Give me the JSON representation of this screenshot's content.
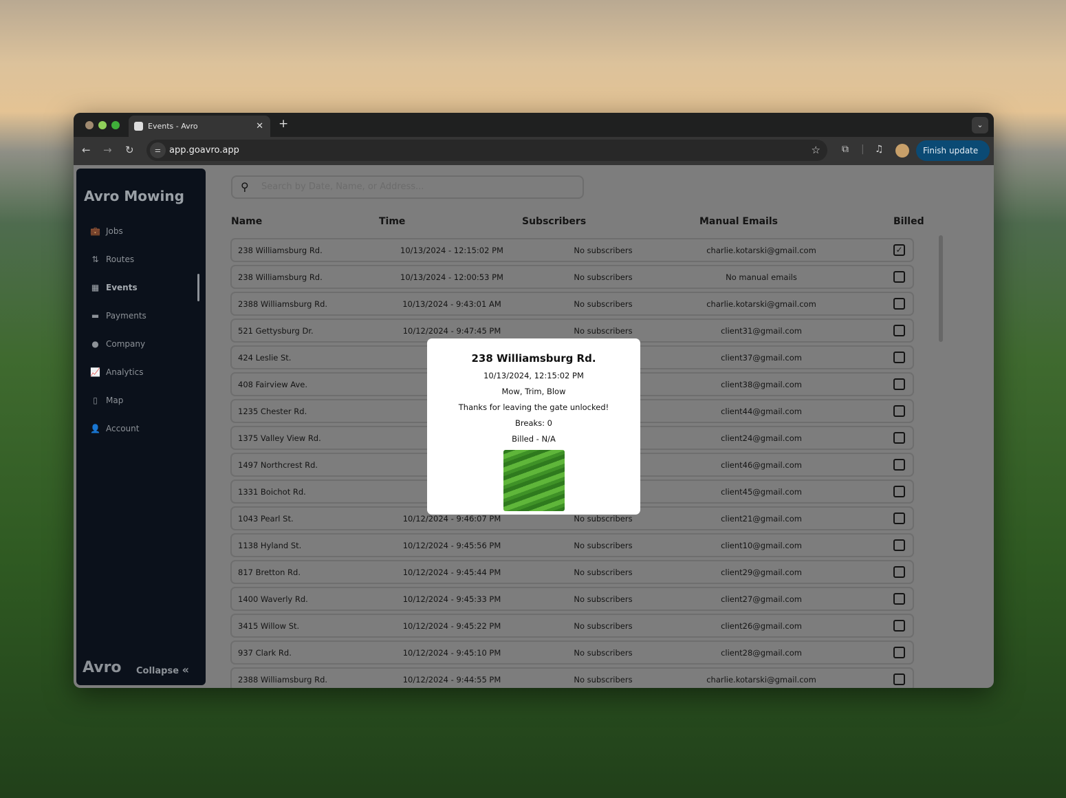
{
  "browser": {
    "tab_title": "Events - Avro",
    "url": "app.goavro.app",
    "finish_update": "Finish update"
  },
  "sidebar": {
    "brand": "Avro Mowing",
    "items": [
      {
        "label": "Jobs",
        "icon": "briefcase-icon",
        "glyph": "💼"
      },
      {
        "label": "Routes",
        "icon": "route-icon",
        "glyph": "⇅"
      },
      {
        "label": "Events",
        "icon": "calendar-icon",
        "glyph": "▦"
      },
      {
        "label": "Payments",
        "icon": "credit-card-icon",
        "glyph": "▬"
      },
      {
        "label": "Company",
        "icon": "info-icon",
        "glyph": "●"
      },
      {
        "label": "Analytics",
        "icon": "chart-line-icon",
        "glyph": "📈"
      },
      {
        "label": "Map",
        "icon": "map-icon",
        "glyph": "▯"
      },
      {
        "label": "Account",
        "icon": "user-icon",
        "glyph": "👤"
      }
    ],
    "active": "Events",
    "footer_logo": "Avro",
    "collapse": "Collapse"
  },
  "search": {
    "placeholder": "Search by Date, Name, or Address..."
  },
  "table": {
    "headers": [
      "Name",
      "Time",
      "Subscribers",
      "Manual Emails",
      "Billed"
    ],
    "rows": [
      {
        "name": "238 Williamsburg Rd.",
        "time": "10/13/2024 - 12:15:02 PM",
        "subs": "No subscribers",
        "email": "charlie.kotarski@gmail.com",
        "billed": true
      },
      {
        "name": "238 Williamsburg Rd.",
        "time": "10/13/2024 - 12:00:53 PM",
        "subs": "No subscribers",
        "email": "No manual emails",
        "billed": false
      },
      {
        "name": "2388 Williamsburg Rd.",
        "time": "10/13/2024 - 9:43:01 AM",
        "subs": "No subscribers",
        "email": "charlie.kotarski@gmail.com",
        "billed": false
      },
      {
        "name": "521 Gettysburg Dr.",
        "time": "10/12/2024 - 9:47:45 PM",
        "subs": "No subscribers",
        "email": "client31@gmail.com",
        "billed": false
      },
      {
        "name": "424 Leslie St.",
        "time": "10/12/2024",
        "subs": "",
        "email": "client37@gmail.com",
        "billed": false
      },
      {
        "name": "408 Fairview Ave.",
        "time": "10/12/2",
        "subs": "",
        "email": "client38@gmail.com",
        "billed": false
      },
      {
        "name": "1235 Chester Rd.",
        "time": "10/12/2",
        "subs": "",
        "email": "client44@gmail.com",
        "billed": false
      },
      {
        "name": "1375 Valley View Rd.",
        "time": "10/12",
        "subs": "s",
        "email": "client24@gmail.com",
        "billed": false
      },
      {
        "name": "1497 Northcrest Rd.",
        "time": "10/12/",
        "subs": "s",
        "email": "client46@gmail.com",
        "billed": false
      },
      {
        "name": "1331 Boichot Rd.",
        "time": "10/12/2",
        "subs": "",
        "email": "client45@gmail.com",
        "billed": false
      },
      {
        "name": "1043 Pearl St.",
        "time": "10/12/2024 - 9:46:07 PM",
        "subs": "No subscribers",
        "email": "client21@gmail.com",
        "billed": false
      },
      {
        "name": "1138 Hyland St.",
        "time": "10/12/2024 - 9:45:56 PM",
        "subs": "No subscribers",
        "email": "client10@gmail.com",
        "billed": false
      },
      {
        "name": "817 Bretton Rd.",
        "time": "10/12/2024 - 9:45:44 PM",
        "subs": "No subscribers",
        "email": "client29@gmail.com",
        "billed": false
      },
      {
        "name": "1400 Waverly Rd.",
        "time": "10/12/2024 - 9:45:33 PM",
        "subs": "No subscribers",
        "email": "client27@gmail.com",
        "billed": false
      },
      {
        "name": "3415 Willow St.",
        "time": "10/12/2024 - 9:45:22 PM",
        "subs": "No subscribers",
        "email": "client26@gmail.com",
        "billed": false
      },
      {
        "name": "937 Clark Rd.",
        "time": "10/12/2024 - 9:45:10 PM",
        "subs": "No subscribers",
        "email": "client28@gmail.com",
        "billed": false
      },
      {
        "name": "2388 Williamsburg Rd.",
        "time": "10/12/2024 - 9:44:55 PM",
        "subs": "No subscribers",
        "email": "charlie.kotarski@gmail.com",
        "billed": false
      }
    ]
  },
  "modal": {
    "title": "238 Williamsburg Rd.",
    "datetime": "10/13/2024, 12:15:02 PM",
    "services": "Mow, Trim, Blow",
    "note": "Thanks for leaving the gate unlocked!",
    "breaks": "Breaks: 0",
    "billed": "Billed - N/A"
  }
}
